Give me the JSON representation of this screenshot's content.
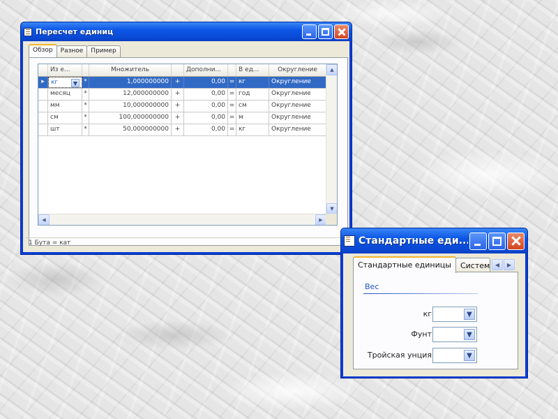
{
  "window1": {
    "title": "Пересчет единиц",
    "tabs": [
      "Обзор",
      "Разное",
      "Пример"
    ],
    "columns": [
      "Из е...",
      "Множитель",
      "Дополни...",
      "В ед...",
      "Округление"
    ],
    "rows": [
      {
        "indicator": "▸",
        "from": "кг",
        "op": "*",
        "mult": "1,000000000",
        "plus": "+",
        "add": "0,00",
        "eq": "=",
        "to": "кг",
        "round": "Округление"
      },
      {
        "indicator": "",
        "from": "месяц",
        "op": "*",
        "mult": "12,000000000",
        "plus": "+",
        "add": "0,00",
        "eq": "=",
        "to": "год",
        "round": "Округление"
      },
      {
        "indicator": "",
        "from": "мм",
        "op": "*",
        "mult": "10,000000000",
        "plus": "+",
        "add": "0,00",
        "eq": "=",
        "to": "см",
        "round": "Округление"
      },
      {
        "indicator": "",
        "from": "см",
        "op": "*",
        "mult": "100,000000000",
        "plus": "+",
        "add": "0,00",
        "eq": "=",
        "to": "м",
        "round": "Округление"
      },
      {
        "indicator": "",
        "from": "шт",
        "op": "*",
        "mult": "50,000000000",
        "plus": "+",
        "add": "0,00",
        "eq": "=",
        "to": "кг",
        "round": "Округление"
      }
    ],
    "status": "1 Бута = кат"
  },
  "window2": {
    "title": "Стандартные еди...",
    "tabs": [
      "Стандартные единицы",
      "Систем"
    ],
    "group_title": "Вес",
    "units": [
      {
        "label": "кг",
        "value": ""
      },
      {
        "label": "Фунт",
        "value": ""
      },
      {
        "label": "Тройская унция",
        "value": ""
      }
    ]
  },
  "icons": {
    "dropdown": "▼",
    "scroll_up": "▲",
    "scroll_down": "▼",
    "scroll_left": "◀",
    "scroll_right": "▶"
  },
  "colors": {
    "titlebar": "#0c56e6",
    "selection": "#316ac5",
    "group_title": "#2152c4",
    "active_tab_accent": "#f5b42a"
  }
}
